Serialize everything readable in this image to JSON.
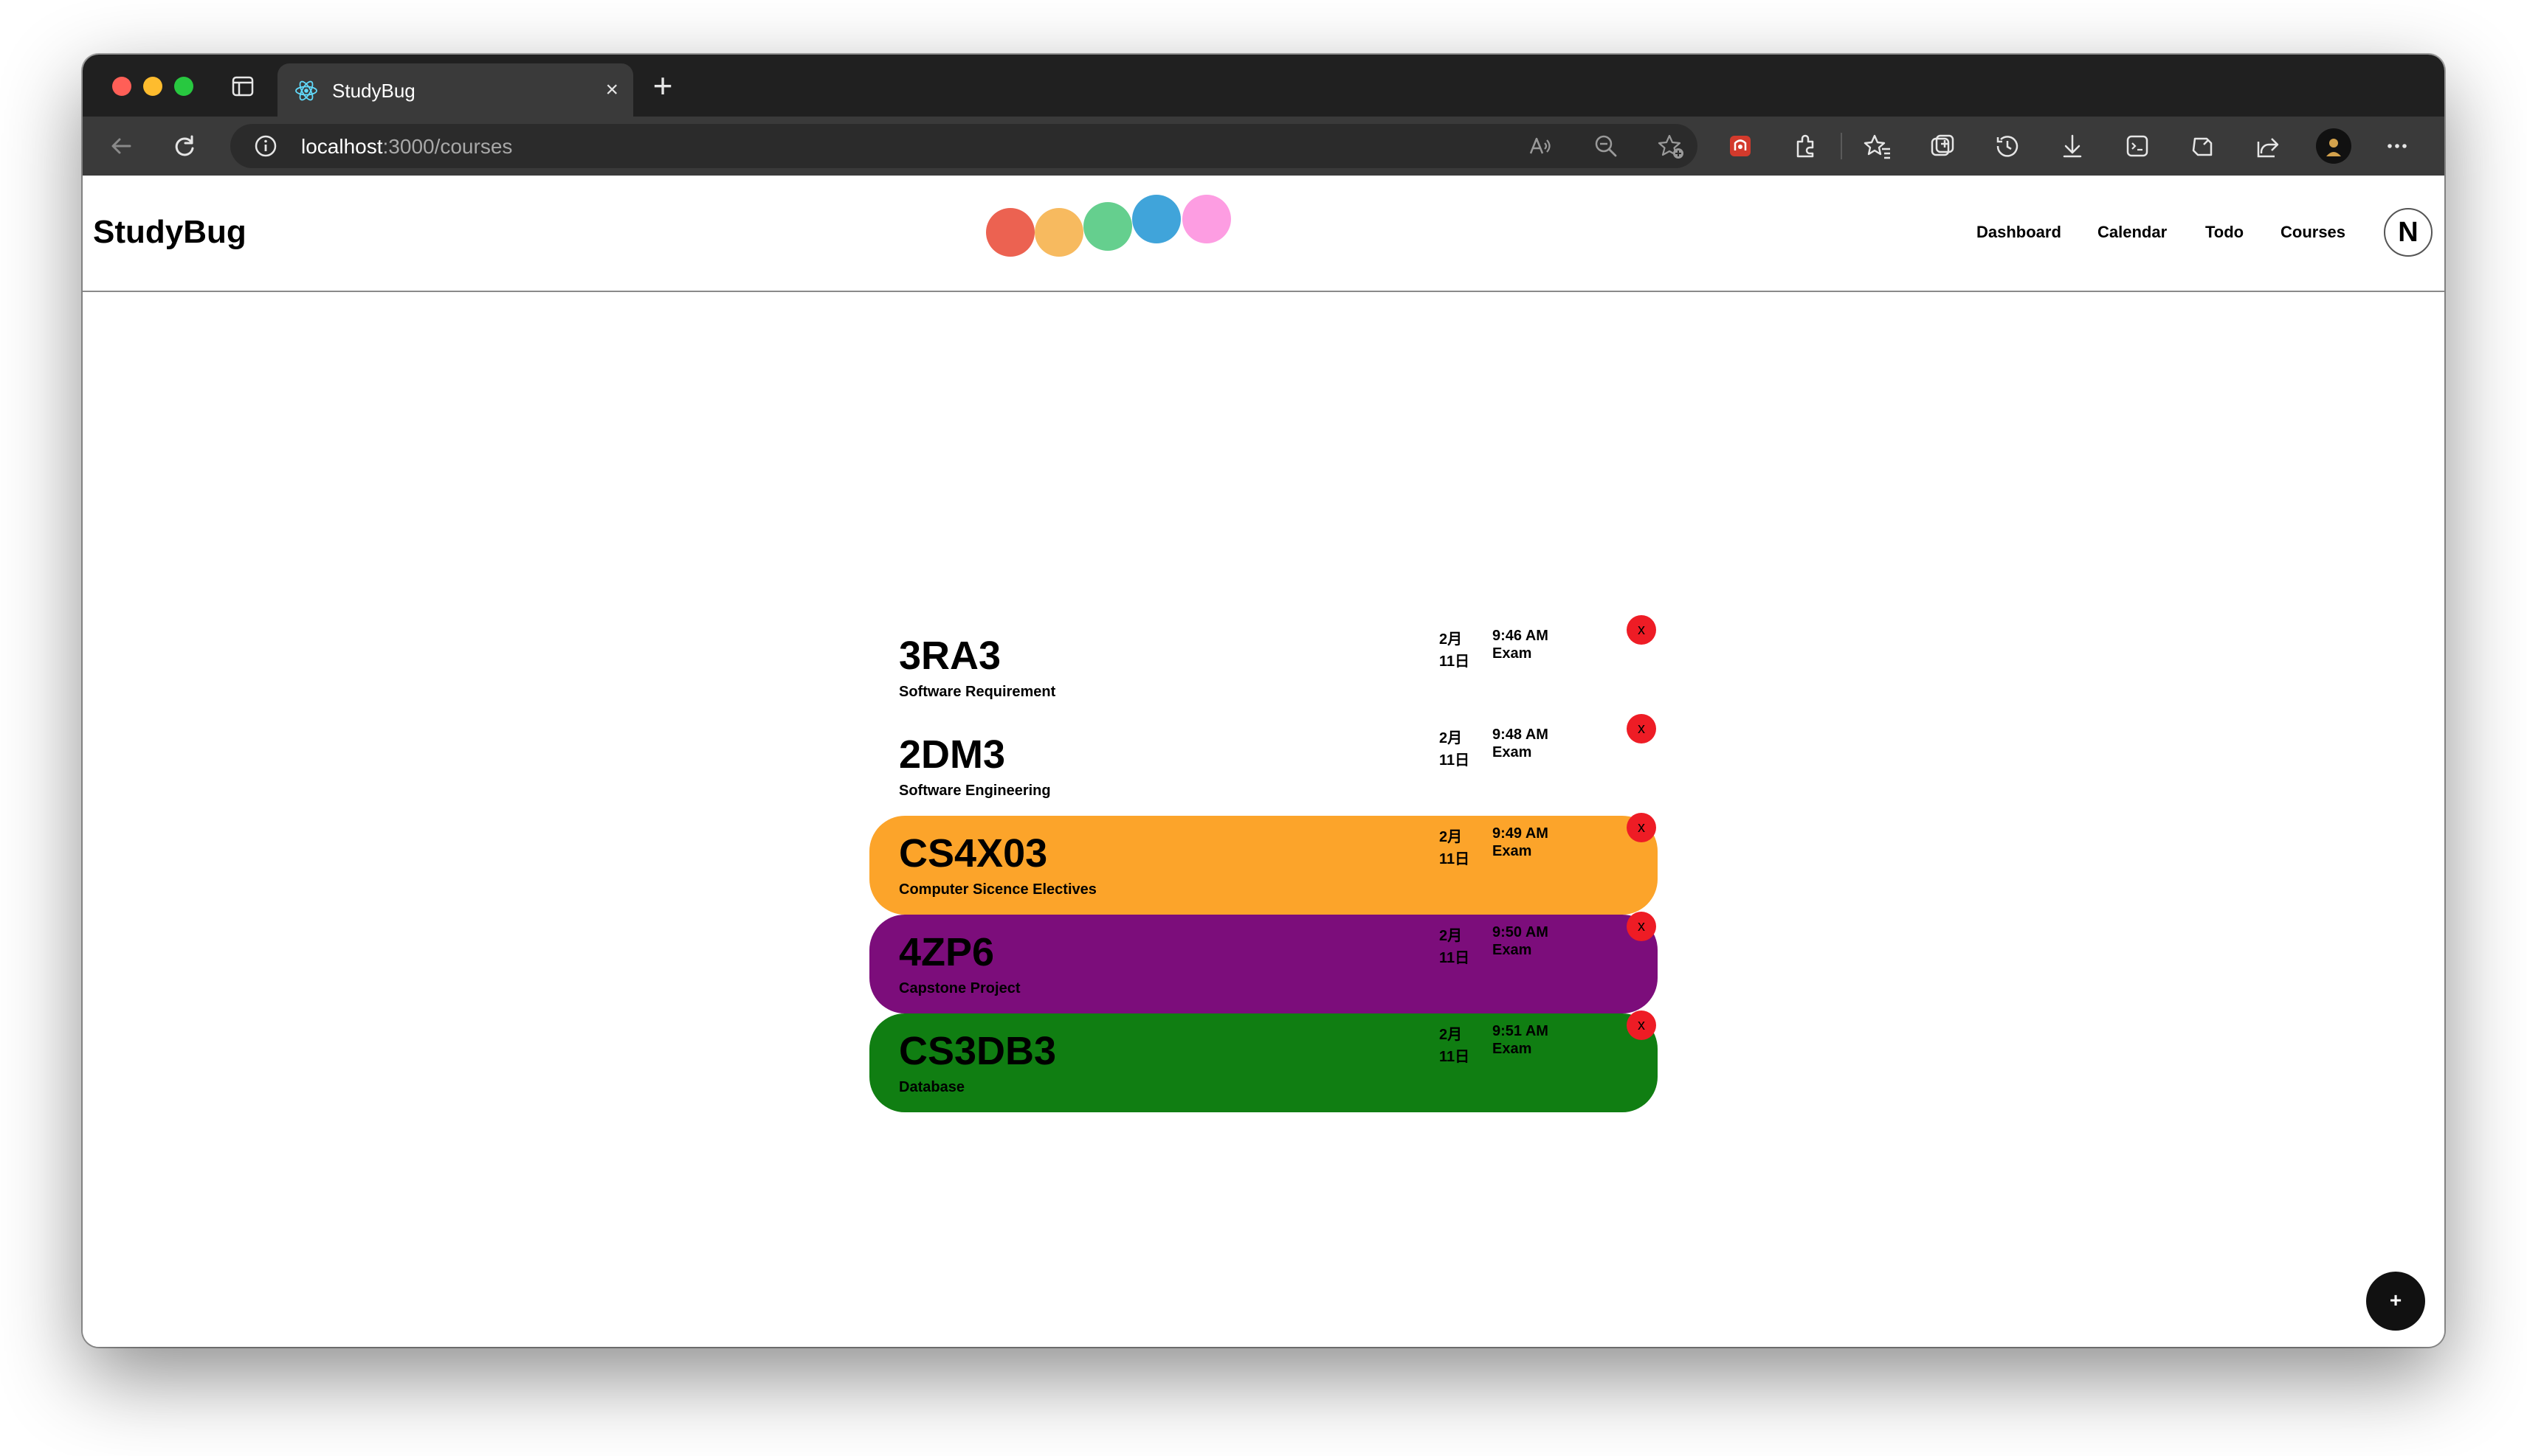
{
  "browser": {
    "tab_title": "StudyBug",
    "tab_close": "×",
    "new_tab": "+",
    "url_host": "localhost",
    "url_path": ":3000/courses",
    "icons": [
      "back-arrow-icon",
      "refresh-icon",
      "info-icon",
      "read-aloud-icon",
      "zoom-icon",
      "favorite-add-icon",
      "extension-red-icon",
      "extensions-icon",
      "favorites-icon",
      "collections-icon",
      "history-icon",
      "downloads-icon",
      "screenshot-icon",
      "copilot-icon",
      "share-icon",
      "profile-icon",
      "more-icon"
    ]
  },
  "app": {
    "brand": "StudyBug",
    "nav": [
      "Dashboard",
      "Calendar",
      "Todo",
      "Courses"
    ],
    "user_initial": "N",
    "logo_dots": [
      "#ec6251",
      "#f7ba5f",
      "#65cf8e",
      "#40a4da",
      "#fd9de2"
    ],
    "fab_label": "+"
  },
  "courses": [
    {
      "code": "3RA3",
      "name": "Software Requirement",
      "month": "2月",
      "day": "11日",
      "time": "9:46 AM",
      "type": "Exam",
      "color": "#ffffff",
      "delete": "x"
    },
    {
      "code": "2DM3",
      "name": "Software Engineering",
      "month": "2月",
      "day": "11日",
      "time": "9:48 AM",
      "type": "Exam",
      "color": "#ffffff",
      "delete": "x"
    },
    {
      "code": "CS4X03",
      "name": "Computer Sicence Electives",
      "month": "2月",
      "day": "11日",
      "time": "9:49 AM",
      "type": "Exam",
      "color": "#fca42a",
      "delete": "x"
    },
    {
      "code": "4ZP6",
      "name": "Capstone Project",
      "month": "2月",
      "day": "11日",
      "time": "9:50 AM",
      "type": "Exam",
      "color": "#7c0d7b",
      "delete": "x"
    },
    {
      "code": "CS3DB3",
      "name": "Database",
      "month": "2月",
      "day": "11日",
      "time": "9:51 AM",
      "type": "Exam",
      "color": "#107e12",
      "delete": "x"
    }
  ]
}
